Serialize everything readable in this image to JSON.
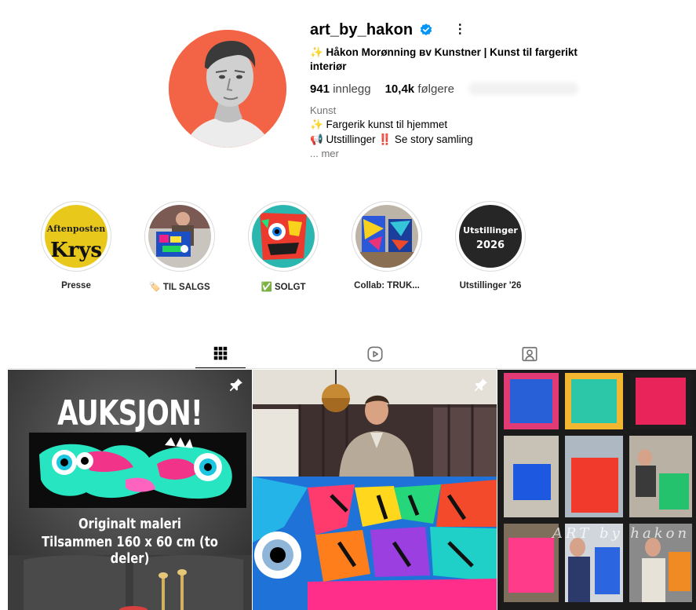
{
  "profile": {
    "username": "art_by_hakon",
    "fullname": "✨ Håkon Morønning ʙv Kunstner | Kunst til fargerikt interiør",
    "stats": {
      "posts_value": "941",
      "posts_label": "innlegg",
      "followers_value": "10,4k",
      "followers_label": "følgere"
    },
    "category": "Kunst",
    "bio": [
      "✨ Fargerik kunst til hjemmet",
      "📢 Utstillinger ‼️ Se story samling"
    ],
    "more_label": "... mer"
  },
  "highlights": [
    {
      "label": "Presse",
      "cover_text_1": "Aftenposten",
      "cover_text_2": "Krys"
    },
    {
      "label": "🏷️ TIL SALGS"
    },
    {
      "label": "✅ SOLGT"
    },
    {
      "label": "Collab: TRUK..."
    },
    {
      "label": "Utstillinger '26",
      "cover_text_1": "Utstillinger",
      "cover_text_2": "2026"
    }
  ],
  "tabs": [
    {
      "name": "posts",
      "icon": "grid-icon",
      "active": true
    },
    {
      "name": "reels",
      "icon": "reels-icon",
      "active": false
    },
    {
      "name": "tagged",
      "icon": "tagged-icon",
      "active": false
    }
  ],
  "posts": {
    "p1": {
      "title": "AUKSJON!",
      "line1": "Originalt maleri",
      "line2": "Tilsammen 160 x 60 cm (to deler)",
      "pinned": true
    },
    "p2": {
      "pinned": true
    },
    "p3": {
      "watermark": "ART by hakon"
    }
  },
  "colors": {
    "accent": "#0095f6",
    "avatar_bg": "#f26445",
    "highlight_ring": "#dbdbdb"
  }
}
